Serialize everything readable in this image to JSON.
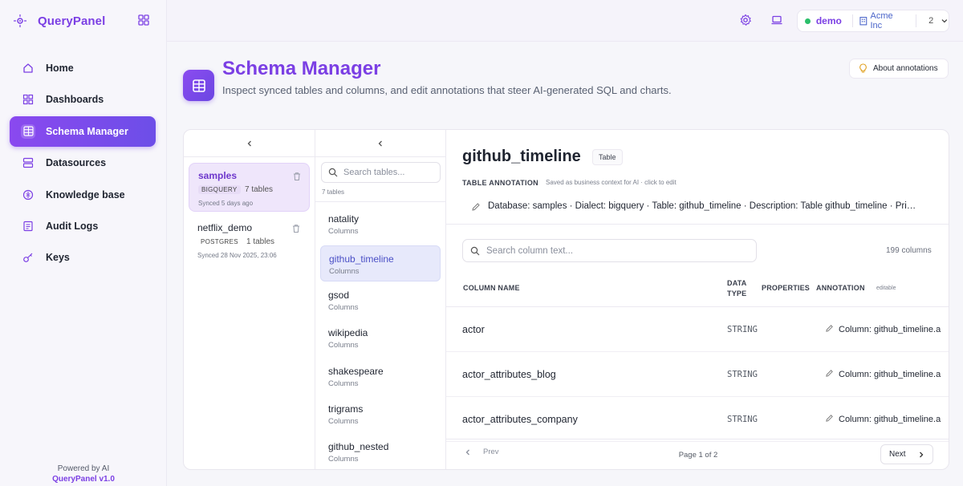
{
  "app": {
    "name": "QueryPanel",
    "powered_by": "Powered by AI",
    "version": "QueryPanel v1.0"
  },
  "sidebar": {
    "items": [
      {
        "label": "Home",
        "icon": "home-icon",
        "active": false
      },
      {
        "label": "Dashboards",
        "icon": "dashboard-icon",
        "active": false
      },
      {
        "label": "Schema Manager",
        "icon": "table-icon",
        "active": true
      },
      {
        "label": "Datasources",
        "icon": "database-icon",
        "active": false
      },
      {
        "label": "Knowledge base",
        "icon": "brain-icon",
        "active": false
      },
      {
        "label": "Audit Logs",
        "icon": "audit-icon",
        "active": false
      },
      {
        "label": "Keys",
        "icon": "key-icon",
        "active": false
      }
    ]
  },
  "topbar": {
    "user": "demo",
    "org": "Acme Inc",
    "count": "2",
    "status_color": "#2bbf6a"
  },
  "header": {
    "title": "Schema Manager",
    "subtitle": "Inspect synced tables and columns, and edit annotations that steer AI-generated SQL and charts.",
    "about_button": "About annotations"
  },
  "datasources": [
    {
      "name": "samples",
      "engine": "BIGQUERY",
      "tables": "7 tables",
      "synced": "Synced 5 days ago",
      "selected": true
    },
    {
      "name": "netflix_demo",
      "engine": "POSTGRES",
      "tables": "1 tables",
      "synced": "Synced 28 Nov 2025, 23:06",
      "selected": false
    }
  ],
  "tables": {
    "search_placeholder": "Search tables...",
    "count": "7 tables",
    "items": [
      {
        "name": "natality",
        "sub": "Columns",
        "selected": false
      },
      {
        "name": "github_timeline",
        "sub": "Columns",
        "selected": true
      },
      {
        "name": "gsod",
        "sub": "Columns",
        "selected": false
      },
      {
        "name": "wikipedia",
        "sub": "Columns",
        "selected": false
      },
      {
        "name": "shakespeare",
        "sub": "Columns",
        "selected": false
      },
      {
        "name": "trigrams",
        "sub": "Columns",
        "selected": false
      },
      {
        "name": "github_nested",
        "sub": "Columns",
        "selected": false
      }
    ]
  },
  "detail": {
    "title": "github_timeline",
    "type_badge": "Table",
    "annotation_label": "TABLE ANNOTATION",
    "annotation_hint": "Saved as business context for AI · click to edit",
    "annotation_text": "Database: samples · Dialect: bigquery · Table: github_timeline · Description: Table github_timeline · Pri…",
    "column_search_placeholder": "Search column text...",
    "column_count": "199 columns",
    "headers": {
      "name": "COLUMN NAME",
      "type_line1": "DATA",
      "type_line2": "TYPE",
      "properties": "PROPERTIES",
      "annotation": "ANNOTATION",
      "editable": "editable"
    },
    "rows": [
      {
        "name": "actor",
        "type": "STRING",
        "annotation": "Column: github_timeline.a"
      },
      {
        "name": "actor_attributes_blog",
        "type": "STRING",
        "annotation": "Column: github_timeline.a"
      },
      {
        "name": "actor_attributes_company",
        "type": "STRING",
        "annotation": "Column: github_timeline.a"
      }
    ],
    "pager": {
      "prev": "Prev",
      "info": "Page 1 of 2",
      "next": "Next"
    }
  }
}
